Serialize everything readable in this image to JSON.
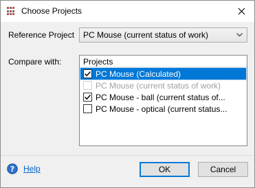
{
  "window": {
    "title": "Choose Projects",
    "close_label": "✕"
  },
  "reference": {
    "label": "Reference Project",
    "selected": "PC Mouse (current status of work)"
  },
  "compare": {
    "label": "Compare with:",
    "list_header": "Projects",
    "items": [
      {
        "label": "PC Mouse (Calculated)",
        "checked": true,
        "selected": true,
        "enabled": true
      },
      {
        "label": "PC Mouse (current status of work)",
        "checked": false,
        "selected": false,
        "enabled": false
      },
      {
        "label": "PC Mouse - ball (current status of...",
        "checked": true,
        "selected": false,
        "enabled": true
      },
      {
        "label": "PC Mouse - optical (current status...",
        "checked": false,
        "selected": false,
        "enabled": true
      }
    ]
  },
  "footer": {
    "help_label": "Help",
    "ok_label": "OK",
    "cancel_label": "Cancel"
  },
  "colors": {
    "selection": "#0078d7",
    "link": "#0066cc",
    "app_icon_accent": "#c0504d"
  }
}
